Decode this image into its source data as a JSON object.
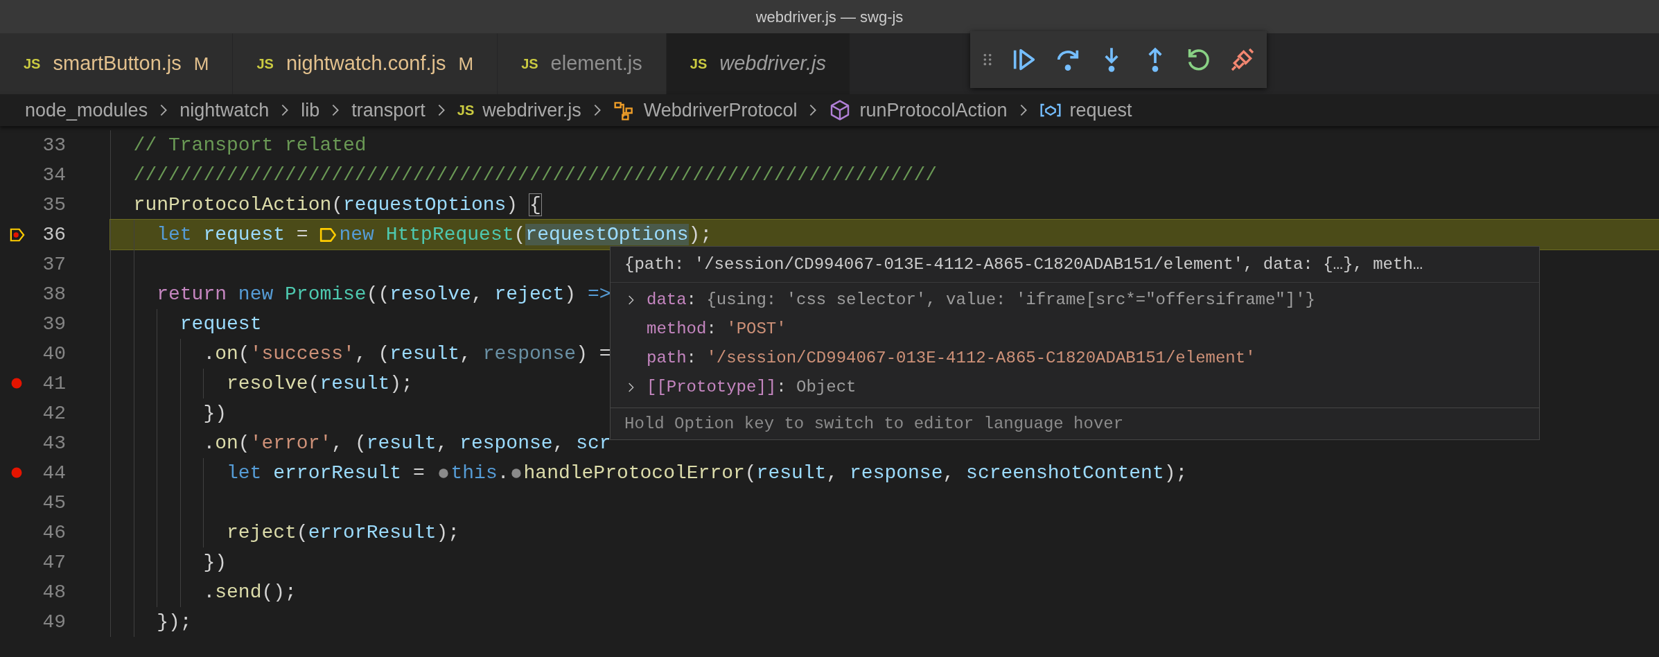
{
  "window": {
    "title": "webdriver.js — swg-js"
  },
  "tabs": [
    {
      "icon": "JS",
      "label": "smartButton.js",
      "badge": "M",
      "modified": true,
      "selected": false,
      "preview": false
    },
    {
      "icon": "JS",
      "label": "nightwatch.conf.js",
      "badge": "M",
      "modified": true,
      "selected": false,
      "preview": false
    },
    {
      "icon": "JS",
      "label": "element.js",
      "modified": false,
      "selected": false,
      "preview": false
    },
    {
      "icon": "JS",
      "label": "webdriver.js",
      "modified": false,
      "selected": true,
      "preview": true
    }
  ],
  "debug_toolbar": {
    "buttons": [
      {
        "kind": "continue"
      },
      {
        "kind": "step-over"
      },
      {
        "kind": "step-into"
      },
      {
        "kind": "step-out"
      },
      {
        "kind": "restart"
      },
      {
        "kind": "disconnect"
      }
    ]
  },
  "breadcrumbs": [
    {
      "label": "node_modules",
      "kind": "folder"
    },
    {
      "label": "nightwatch",
      "kind": "folder"
    },
    {
      "label": "lib",
      "kind": "folder"
    },
    {
      "label": "transport",
      "kind": "folder"
    },
    {
      "label": "webdriver.js",
      "kind": "file",
      "icon": "JS"
    },
    {
      "label": "WebdriverProtocol",
      "kind": "class"
    },
    {
      "label": "runProtocolAction",
      "kind": "method"
    },
    {
      "label": "request",
      "kind": "variable"
    }
  ],
  "editor": {
    "lines": [
      {
        "number": "33",
        "current": false,
        "tokens": [
          {
            "kind": "comment",
            "text": "// Transport related"
          }
        ]
      },
      {
        "number": "34",
        "current": false,
        "tokens": [
          {
            "kind": "comment",
            "text": "/////////////////////////////////////////////////////////////////////"
          }
        ]
      },
      {
        "number": "35",
        "current": false,
        "tokens": [
          {
            "kind": "fn",
            "text": "runProtocolAction"
          },
          {
            "kind": "punct",
            "text": "("
          },
          {
            "kind": "var",
            "text": "requestOptions"
          },
          {
            "kind": "punct",
            "text": ") "
          },
          {
            "kind": "bracket-match",
            "text": "{"
          }
        ],
        "children": [
          {
            "number": "36",
            "breakpoint": true,
            "current": true,
            "tokens": [
              {
                "kind": "kw",
                "text": "let "
              },
              {
                "kind": "var",
                "text": "request"
              },
              {
                "kind": "punct",
                "text": " = "
              },
              {
                "kind": "stop-current"
              },
              {
                "kind": "kw",
                "text": "new "
              },
              {
                "kind": "class",
                "text": "HttpRequest"
              },
              {
                "kind": "punct",
                "text": "("
              },
              {
                "kind": "var-hl",
                "text": "requestOptions"
              },
              {
                "kind": "punct",
                "text": ");"
              }
            ]
          },
          {
            "number": "37",
            "current": false
          },
          {
            "number": "38",
            "current": false,
            "tokens": [
              {
                "kind": "ctrl",
                "text": "return "
              },
              {
                "kind": "kw",
                "text": "new "
              },
              {
                "kind": "class",
                "text": "Promise"
              },
              {
                "kind": "punct",
                "text": "(("
              },
              {
                "kind": "param",
                "text": "resolve"
              },
              {
                "kind": "punct",
                "text": ", "
              },
              {
                "kind": "param",
                "text": "reject"
              },
              {
                "kind": "punct",
                "text": ") "
              },
              {
                "kind": "kw",
                "text": "=>"
              }
            ],
            "children": [
              {
                "number": "39",
                "current": false,
                "tokens": [
                  {
                    "kind": "var",
                    "text": "request"
                  }
                ],
                "children": [
                  {
                    "number": "40",
                    "current": false,
                    "tokens": [
                      {
                        "kind": "punct",
                        "text": "."
                      },
                      {
                        "kind": "fn",
                        "text": "on"
                      },
                      {
                        "kind": "punct",
                        "text": "("
                      },
                      {
                        "kind": "str",
                        "text": "'success'"
                      },
                      {
                        "kind": "punct",
                        "text": ", ("
                      },
                      {
                        "kind": "var",
                        "text": "result"
                      },
                      {
                        "kind": "punct",
                        "text": ", "
                      },
                      {
                        "kind": "var-dim",
                        "text": "response"
                      },
                      {
                        "kind": "punct",
                        "text": ") ="
                      }
                    ],
                    "children": [
                      {
                        "number": "41",
                        "breakpoint": true,
                        "current": false,
                        "tokens": [
                          {
                            "kind": "fn",
                            "text": "resolve"
                          },
                          {
                            "kind": "punct",
                            "text": "("
                          },
                          {
                            "kind": "var",
                            "text": "result"
                          },
                          {
                            "kind": "punct",
                            "text": ");"
                          }
                        ]
                      }
                    ]
                  },
                  {
                    "number": "42",
                    "current": false,
                    "tokens": [
                      {
                        "kind": "punct",
                        "text": "})"
                      }
                    ]
                  },
                  {
                    "number": "43",
                    "current": false,
                    "tokens": [
                      {
                        "kind": "punct",
                        "text": "."
                      },
                      {
                        "kind": "fn",
                        "text": "on"
                      },
                      {
                        "kind": "punct",
                        "text": "("
                      },
                      {
                        "kind": "str",
                        "text": "'error'"
                      },
                      {
                        "kind": "punct",
                        "text": ", ("
                      },
                      {
                        "kind": "var",
                        "text": "result"
                      },
                      {
                        "kind": "punct",
                        "text": ", "
                      },
                      {
                        "kind": "var",
                        "text": "response"
                      },
                      {
                        "kind": "punct",
                        "text": ", "
                      },
                      {
                        "kind": "var",
                        "text": "scr"
                      }
                    ],
                    "children": [
                      {
                        "number": "44",
                        "breakpoint": true,
                        "current": false,
                        "tokens": [
                          {
                            "kind": "kw",
                            "text": "let "
                          },
                          {
                            "kind": "var",
                            "text": "errorResult"
                          },
                          {
                            "kind": "punct",
                            "text": " = "
                          },
                          {
                            "kind": "stop-candidate"
                          },
                          {
                            "kind": "kw",
                            "text": "this"
                          },
                          {
                            "kind": "punct",
                            "text": "."
                          },
                          {
                            "kind": "stop-candidate"
                          },
                          {
                            "kind": "fn",
                            "text": "handleProtocolError"
                          },
                          {
                            "kind": "punct",
                            "text": "("
                          },
                          {
                            "kind": "var",
                            "text": "result"
                          },
                          {
                            "kind": "punct",
                            "text": ", "
                          },
                          {
                            "kind": "var",
                            "text": "response"
                          },
                          {
                            "kind": "punct",
                            "text": ", "
                          },
                          {
                            "kind": "var",
                            "text": "screenshotContent"
                          },
                          {
                            "kind": "punct",
                            "text": ");"
                          }
                        ]
                      },
                      {
                        "number": "45",
                        "current": false
                      },
                      {
                        "number": "46",
                        "current": false,
                        "tokens": [
                          {
                            "kind": "fn",
                            "text": "reject"
                          },
                          {
                            "kind": "punct",
                            "text": "("
                          },
                          {
                            "kind": "var",
                            "text": "errorResult"
                          },
                          {
                            "kind": "punct",
                            "text": ");"
                          }
                        ]
                      }
                    ]
                  },
                  {
                    "number": "47",
                    "current": false,
                    "tokens": [
                      {
                        "kind": "punct",
                        "text": "})"
                      }
                    ]
                  },
                  {
                    "number": "48",
                    "current": false,
                    "tokens": [
                      {
                        "kind": "punct",
                        "text": "."
                      },
                      {
                        "kind": "fn",
                        "text": "send"
                      },
                      {
                        "kind": "punct",
                        "text": "();"
                      }
                    ]
                  }
                ]
              }
            ]
          },
          {
            "number": "49",
            "current": false,
            "tokens": [
              {
                "kind": "punct",
                "text": "});"
              }
            ]
          }
        ]
      }
    ]
  },
  "hover": {
    "header": "{path: '/session/CD994067-013E-4112-A865-C1820ADAB151/element', data: {…}, meth…",
    "rows": [
      {
        "key": "data",
        "separator": ":",
        "value": "{using: 'css selector', value: 'iframe[src*=\"offersiframe\"]'}",
        "expandable": true,
        "kind": "preview"
      },
      {
        "key": "method",
        "separator": ":",
        "value": "'POST'",
        "kind": "string"
      },
      {
        "key": "path",
        "separator": ":",
        "value": "'/session/CD994067-013E-4112-A865-C1820ADAB151/element'",
        "kind": "string"
      },
      {
        "key": "[[Prototype]]",
        "separator": ":",
        "value": "Object",
        "expandable": true,
        "kind": "preview"
      }
    ],
    "footer": "Hold Option key to switch to editor language hover"
  }
}
